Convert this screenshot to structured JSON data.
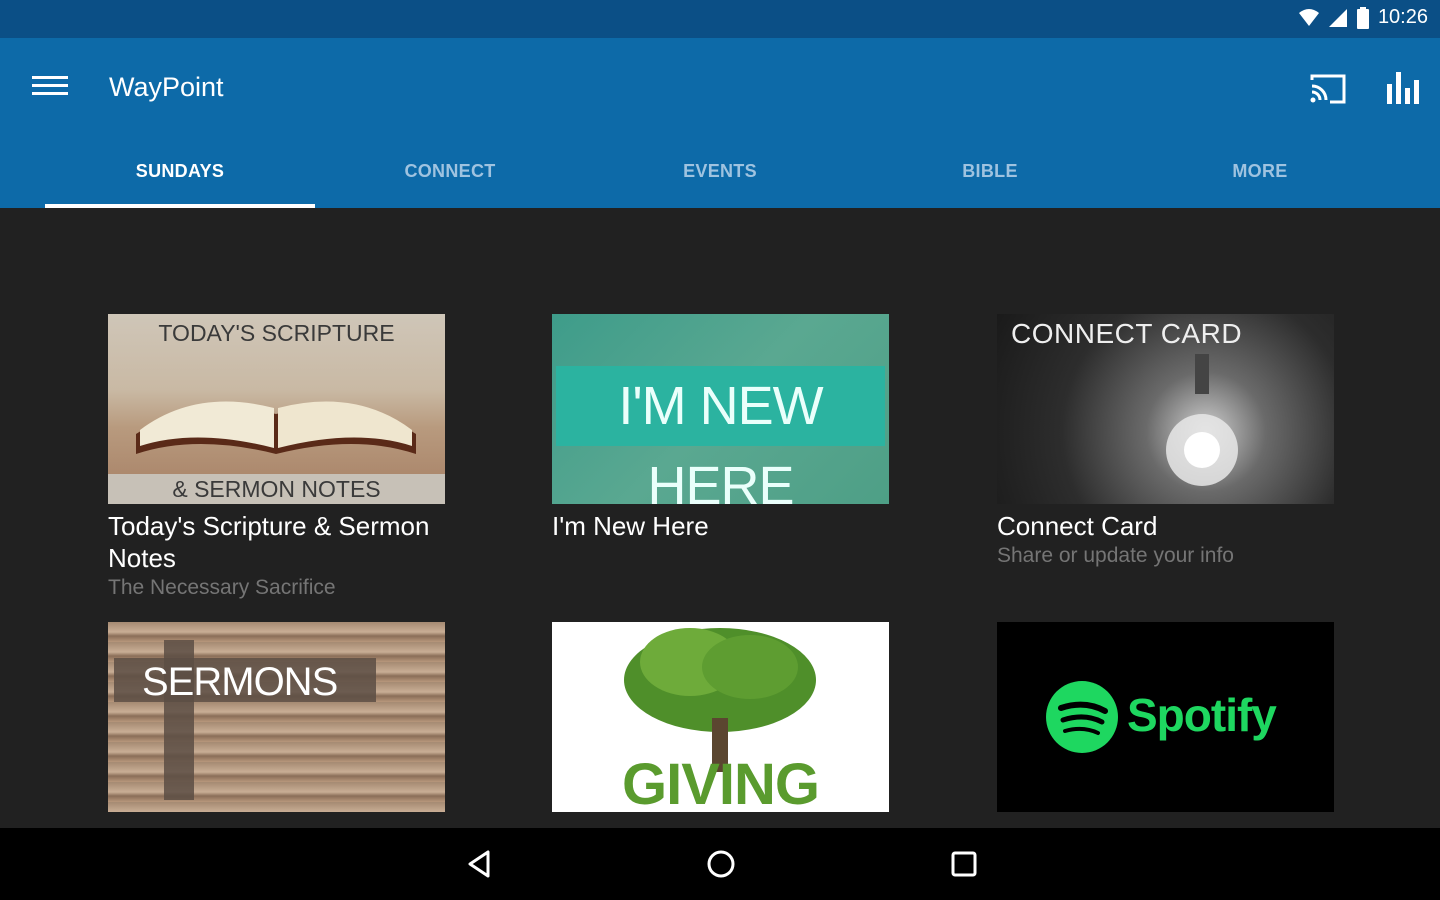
{
  "status": {
    "time": "10:26"
  },
  "app": {
    "title": "WayPoint"
  },
  "tabs": [
    {
      "label": "SUNDAYS",
      "active": true
    },
    {
      "label": "CONNECT",
      "active": false
    },
    {
      "label": "EVENTS",
      "active": false
    },
    {
      "label": "BIBLE",
      "active": false
    },
    {
      "label": "MORE",
      "active": false
    }
  ],
  "cards": [
    {
      "thumb_top": "TODAY'S SCRIPTURE",
      "thumb_bottom": "& SERMON NOTES",
      "title": "Today's Scripture & Sermon Notes",
      "subtitle": "The Necessary Sacrifice"
    },
    {
      "thumb_text": "I'M NEW HERE",
      "title": "I'm New Here",
      "subtitle": ""
    },
    {
      "thumb_text": "CONNECT  CARD",
      "title": "Connect Card",
      "subtitle": "Share or update your info"
    },
    {
      "thumb_text": "SERMONS"
    },
    {
      "thumb_text": "GIVING"
    },
    {
      "thumb_text": "Spotify"
    }
  ],
  "colors": {
    "statusbar": "#0b4f86",
    "appbar": "#0d6aa8",
    "background": "#212121",
    "spotify_green": "#1ed760"
  },
  "icons": [
    "menu-icon",
    "cast-icon",
    "bar-chart-icon",
    "wifi-icon",
    "signal-icon",
    "battery-icon",
    "back-icon",
    "home-icon",
    "recents-icon"
  ]
}
